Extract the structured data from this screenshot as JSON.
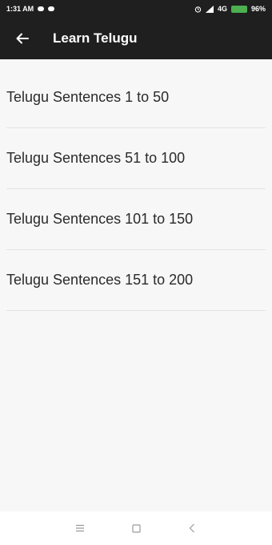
{
  "status_bar": {
    "time": "1:31 AM",
    "network": "4G",
    "battery": "96%"
  },
  "app_bar": {
    "title": "Learn Telugu",
    "back_icon": "arrow-left-icon"
  },
  "list": {
    "items": [
      {
        "label": "Telugu Sentences 1 to 50"
      },
      {
        "label": "Telugu Sentences 51 to 100"
      },
      {
        "label": "Telugu Sentences 101 to 150"
      },
      {
        "label": "Telugu Sentences 151 to 200"
      }
    ]
  },
  "nav_bar": {
    "icons": [
      "menu-icon",
      "home-square-icon",
      "back-chevron-icon"
    ]
  },
  "colors": {
    "app_bar": "#1f1f1f",
    "background": "#f7f7f7",
    "divider": "#e3e3e3",
    "battery": "#4caf50"
  }
}
